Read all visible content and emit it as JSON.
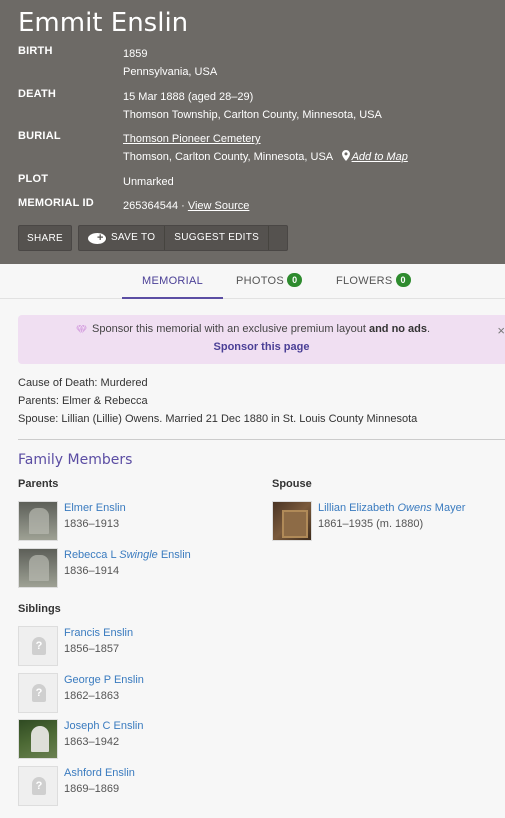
{
  "memorial": {
    "name": "Emmit Enslin",
    "birth": {
      "label": "BIRTH",
      "date": "1859",
      "place": "Pennsylvania, USA"
    },
    "death": {
      "label": "DEATH",
      "date": "15 Mar 1888 (aged 28–29)",
      "place": "Thomson Township, Carlton County, Minnesota, USA"
    },
    "burial": {
      "label": "BURIAL",
      "cemetery": "Thomson Pioneer Cemetery",
      "place": "Thomson, Carlton County, Minnesota, USA",
      "map_link": "Add to Map"
    },
    "plot": {
      "label": "PLOT",
      "value": "Unmarked"
    },
    "memorial_id": {
      "label": "MEMORIAL ID",
      "value": "265364544",
      "separator": " · ",
      "source_link": "View Source"
    }
  },
  "actions": {
    "share": "SHARE",
    "save_to": "SAVE TO",
    "suggest_edits": "SUGGEST EDITS"
  },
  "tabs": [
    {
      "label": "MEMORIAL",
      "active": true
    },
    {
      "label": "PHOTOS",
      "count": "0"
    },
    {
      "label": "FLOWERS",
      "count": "0"
    }
  ],
  "sponsor": {
    "text": "Sponsor this memorial with an exclusive premium layout",
    "text_bold": "and no ads",
    "text_end": ".",
    "link": "Sponsor this page",
    "close": "×"
  },
  "details": {
    "cause": "Cause of Death: Murdered",
    "parents": "Parents: Elmer & Rebecca",
    "spouse": "Spouse: Lillian (Lillie) Owens. Married 21 Dec 1880 in St. Louis County Minnesota"
  },
  "family": {
    "title": "Family Members",
    "parents_label": "Parents",
    "spouse_label": "Spouse",
    "siblings_label": "Siblings",
    "parents": [
      {
        "name": "Elmer Enslin",
        "dates": "1836–1913"
      },
      {
        "first": "Rebecca L ",
        "maiden": "Swingle",
        "last": " Enslin",
        "dates": "1836–1914"
      }
    ],
    "spouse": {
      "first": "Lillian Elizabeth ",
      "maiden": "Owens",
      "last": " Mayer",
      "dates": "1861–1935 (m. 1880)"
    },
    "siblings": [
      {
        "name": "Francis Enslin",
        "dates": "1856–1857"
      },
      {
        "name": "George P Enslin",
        "dates": "1862–1863"
      },
      {
        "name": "Joseph C Enslin",
        "dates": "1863–1942"
      },
      {
        "name": "Ashford Enslin",
        "dates": "1869–1869"
      }
    ]
  },
  "colors": {
    "hero_bg": "#6d6a66",
    "accent": "#5b4da3",
    "link": "#3a7bbf",
    "badge": "#2e8b2e",
    "sponsor_bg": "#f0dff2"
  }
}
